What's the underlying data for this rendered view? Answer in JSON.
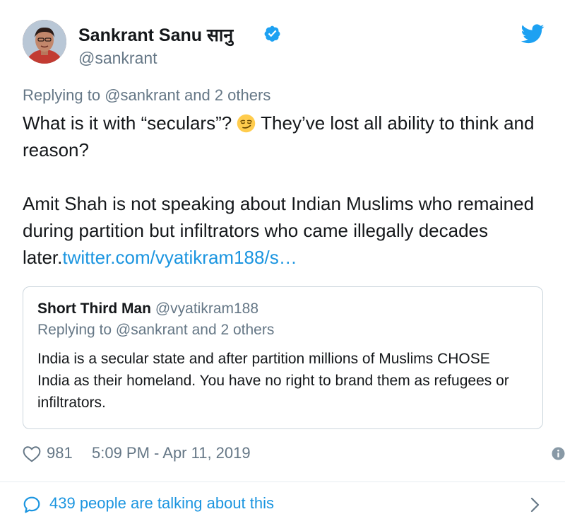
{
  "author": {
    "display_name": "Sankrant Sanu सानु",
    "handle": "@sankrant",
    "verified": true
  },
  "tweet": {
    "replying_prefix": "Replying to ",
    "replying_mention": "@sankrant",
    "replying_suffix": " and 2 others",
    "line1_before_emoji": "What is it with “seculars”? ",
    "emoji": "smirking-face",
    "line1_after_emoji": " They’ve lost all ability to think and reason?",
    "paragraph2": "Amit Shah is not speaking about Indian Muslims who remained during partition but infiltrators who came illegally decades later.",
    "link_text": "twitter.com/vyatikram188/s…"
  },
  "quoted_tweet": {
    "display_name": "Short Third Man",
    "handle": "@vyatikram188",
    "replying": "Replying to @sankrant and 2 others",
    "text": "India is a secular state and after partition millions of Muslims CHOSE India as their homeland. You have no right to brand them as refugees or infiltrators."
  },
  "meta": {
    "likes": "981",
    "timestamp": "5:09 PM - Apr 11, 2019"
  },
  "conversation": {
    "label": "439 people are talking about this"
  },
  "colors": {
    "twitter_blue": "#1b95e0",
    "text": "#14171a",
    "secondary": "#657786",
    "border": "#ccd6dd",
    "divider": "#e6ecf0"
  },
  "icons": [
    "verified-badge-icon",
    "twitter-bird-icon",
    "smirking-face-emoji",
    "heart-icon",
    "info-icon",
    "chat-bubble-icon",
    "chevron-right-icon"
  ]
}
